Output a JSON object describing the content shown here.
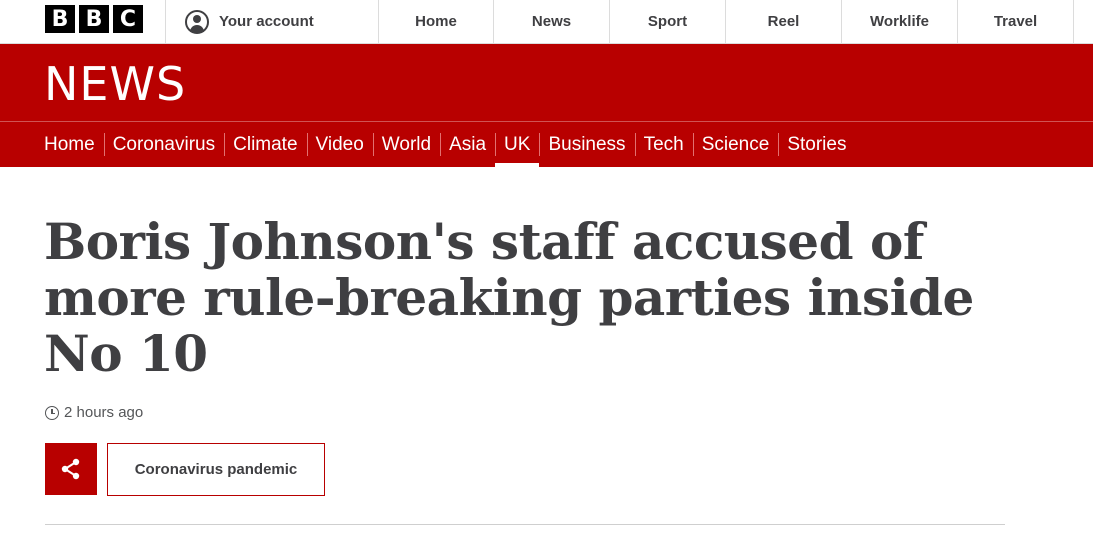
{
  "brand": {
    "logo_letters": [
      "B",
      "B",
      "C"
    ],
    "section_title": "NEWS",
    "accent_color": "#b80000"
  },
  "account": {
    "label": "Your account",
    "icon": "user-account-icon"
  },
  "global_nav": {
    "items": [
      "Home",
      "News",
      "Sport",
      "Reel",
      "Worklife",
      "Travel"
    ]
  },
  "news_nav": {
    "items": [
      "Home",
      "Coronavirus",
      "Climate",
      "Video",
      "World",
      "Asia",
      "UK",
      "Business",
      "Tech",
      "Science",
      "Stories"
    ],
    "active": "UK"
  },
  "article": {
    "headline": "Boris Johnson's staff accused of more rule-breaking parties inside No 10",
    "timestamp": "2 hours ago",
    "timestamp_icon": "clock-icon",
    "share_icon": "share-icon",
    "topic_tag": "Coronavirus pandemic"
  }
}
